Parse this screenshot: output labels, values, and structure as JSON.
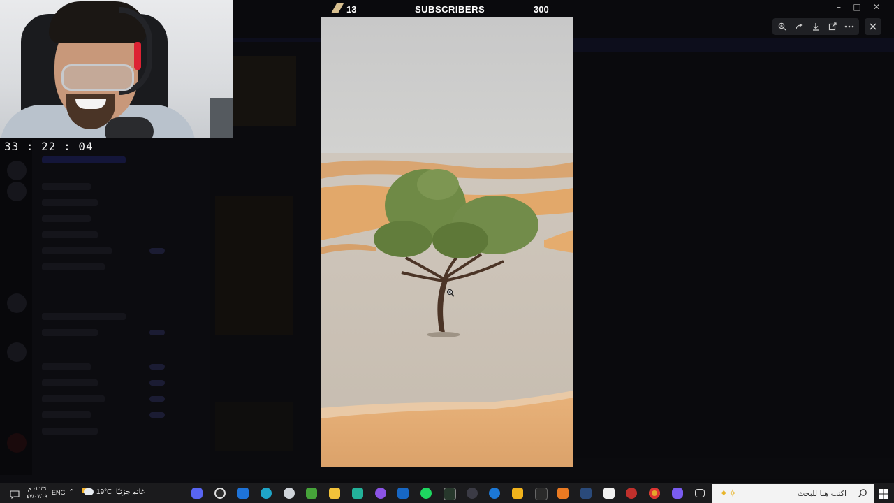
{
  "stream": {
    "timer": "33 : 22 : 04",
    "counter_value": "13",
    "counter_label": "SUBSCRIBERS",
    "counter_goal": "300"
  },
  "viewer": {
    "toolbar_icons": [
      "zoom-in-icon",
      "share-icon",
      "download-icon",
      "open-external-icon",
      "more-icon"
    ],
    "close_icon": "close-icon"
  },
  "window_controls": [
    "minimize-icon",
    "maximize-icon",
    "close-icon"
  ],
  "taskbar": {
    "time": "٠٢:٣٦ م",
    "date": "٤٧/٠٧/٠٩",
    "language": "ENG",
    "weather_temp": "19°C",
    "weather_text": "غائم جزئيًا",
    "search_placeholder": "اكتب هنا للبحث",
    "apps": [
      "discord",
      "obs",
      "outlook-mail",
      "edge",
      "app-4",
      "app-5",
      "file-explorer",
      "app-7",
      "app-8",
      "outlook",
      "spotify",
      "excel",
      "app-12",
      "app-13",
      "rockstar",
      "epic-games",
      "app-16",
      "steam",
      "app-18",
      "app-19",
      "chrome",
      "copilot",
      "task-view"
    ]
  },
  "colors": {
    "accent": "#5865f2",
    "taskbar": "#1b1b1d",
    "sand": "#e2a86a"
  }
}
